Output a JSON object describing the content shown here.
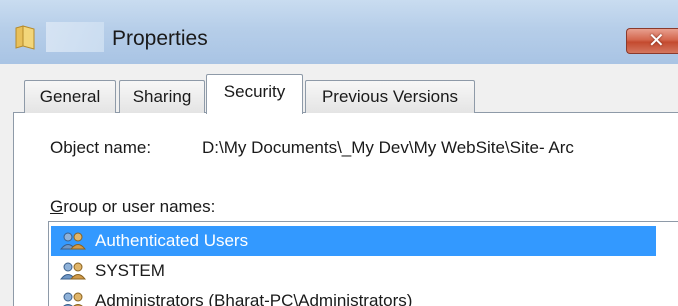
{
  "window": {
    "title": "Properties"
  },
  "tabs": [
    {
      "label": "General"
    },
    {
      "label": "Sharing"
    },
    {
      "label": "Security"
    },
    {
      "label": "Previous Versions"
    }
  ],
  "object": {
    "label": "Object name:",
    "value": "D:\\My Documents\\_My Dev\\My WebSite\\Site- Arc"
  },
  "group": {
    "label_prefix": "G",
    "label_rest": "roup or user names:",
    "items": [
      {
        "label": "Authenticated Users",
        "icon": "users-icon"
      },
      {
        "label": "SYSTEM",
        "icon": "users-icon"
      },
      {
        "label": "Administrators (Bharat-PC\\Administrators)",
        "icon": "users-icon"
      }
    ]
  },
  "colors": {
    "selection": "#3399ff",
    "close_button": "#c44a2f"
  }
}
